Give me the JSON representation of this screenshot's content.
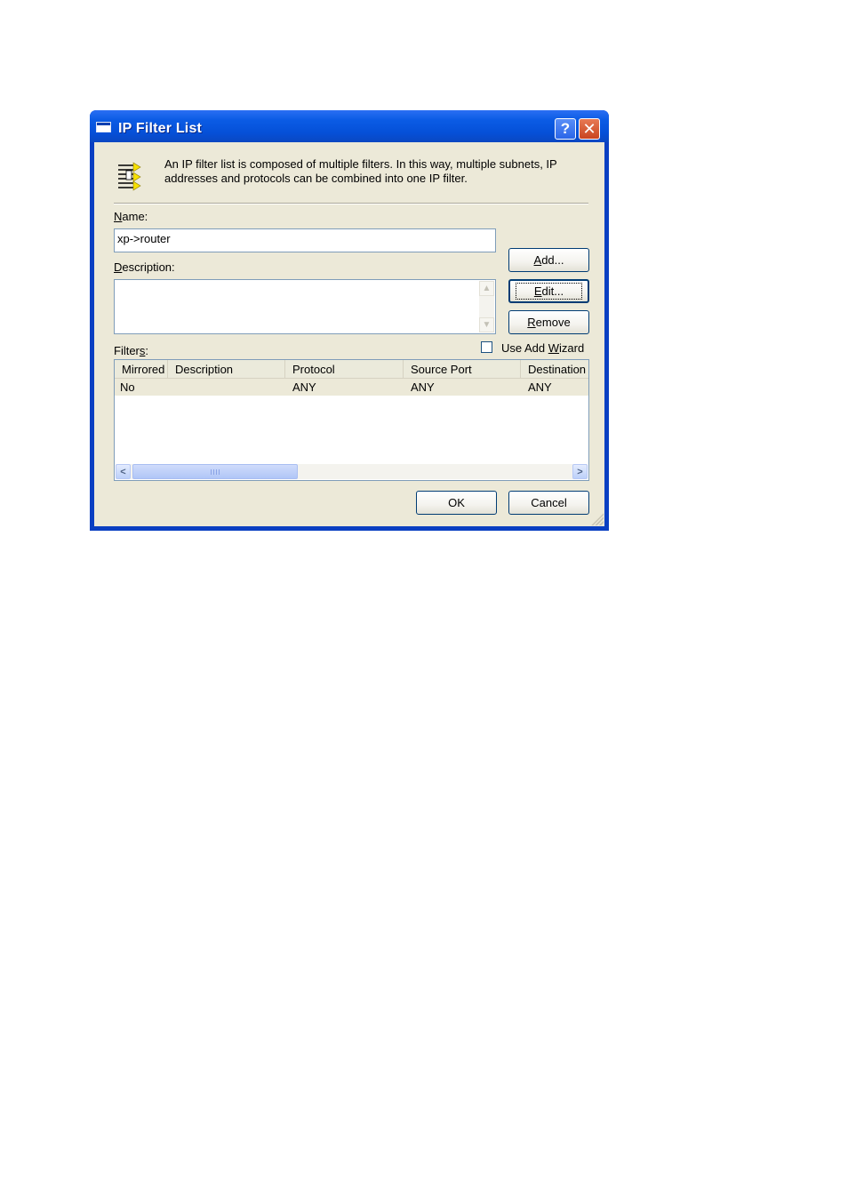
{
  "window": {
    "title": "IP Filter List",
    "help_glyph": "?",
    "close_glyph": "✕",
    "accent_color": "#0a3fc2"
  },
  "info": {
    "text": "An IP filter list is composed of multiple filters. In this way, multiple subnets, IP addresses and protocols can be combined into one IP filter.",
    "icon": "filter-list-icon"
  },
  "name_field": {
    "label_first": "N",
    "label_rest": "ame:",
    "value": "xp->router"
  },
  "description_field": {
    "label_first": "D",
    "label_rest": "escription:",
    "value": ""
  },
  "buttons": {
    "add_first": "A",
    "add_rest": "dd...",
    "edit_first": "E",
    "edit_rest": "dit...",
    "remove_first": "R",
    "remove_rest": "emove",
    "ok": "OK",
    "cancel": "Cancel"
  },
  "filters": {
    "label_pre": "Filter",
    "label_ul": "s",
    "label_post": ":",
    "wizard_label_pre": "Use Add ",
    "wizard_label_ul": "W",
    "wizard_label_post": "izard",
    "wizard_checked": false,
    "columns": [
      "Mirrored",
      "Description",
      "Protocol",
      "Source Port",
      "Destination"
    ],
    "rows": [
      {
        "mirrored": "No",
        "description": "",
        "protocol": "ANY",
        "source_port": "ANY",
        "destination": "ANY"
      }
    ]
  }
}
